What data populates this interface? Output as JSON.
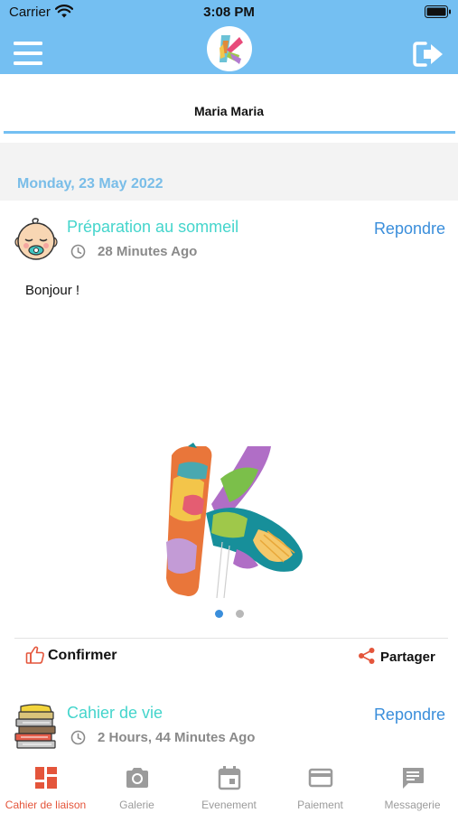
{
  "status_bar": {
    "carrier": "Carrier",
    "time": "3:08 PM"
  },
  "header": {
    "menu_icon": "hamburger-menu-icon",
    "logo": "app-logo",
    "logout_icon": "logout-icon",
    "color": "#74bff2"
  },
  "child_tab": {
    "name": "Maria Maria"
  },
  "feed": {
    "date": "Monday, 23 May 2022",
    "posts": [
      {
        "title": "Préparation au sommeil",
        "reply_label": "Repondre",
        "time": "28 Minutes Ago",
        "body": "Bonjour !",
        "avatar_icon": "sleeping-baby-icon",
        "image_icon": "k-logo-illustration",
        "carousel": {
          "count": 2,
          "active_index": 0
        },
        "confirm_label": "Confirmer",
        "share_label": "Partager"
      },
      {
        "title": "Cahier de vie",
        "reply_label": "Repondre",
        "time": "2 Hours, 44 Minutes Ago",
        "avatar_icon": "book-stack-icon"
      }
    ]
  },
  "tabbar": {
    "active_color": "#e4553b",
    "inactive_color": "#9b9b9b",
    "items": [
      {
        "label": "Cahier de liaison",
        "icon": "dashboard-icon",
        "active": true
      },
      {
        "label": "Galerie",
        "icon": "camera-icon",
        "active": false
      },
      {
        "label": "Evenement",
        "icon": "calendar-icon",
        "active": false
      },
      {
        "label": "Paiement",
        "icon": "credit-card-icon",
        "active": false
      },
      {
        "label": "Messagerie",
        "icon": "message-icon",
        "active": false
      }
    ]
  }
}
